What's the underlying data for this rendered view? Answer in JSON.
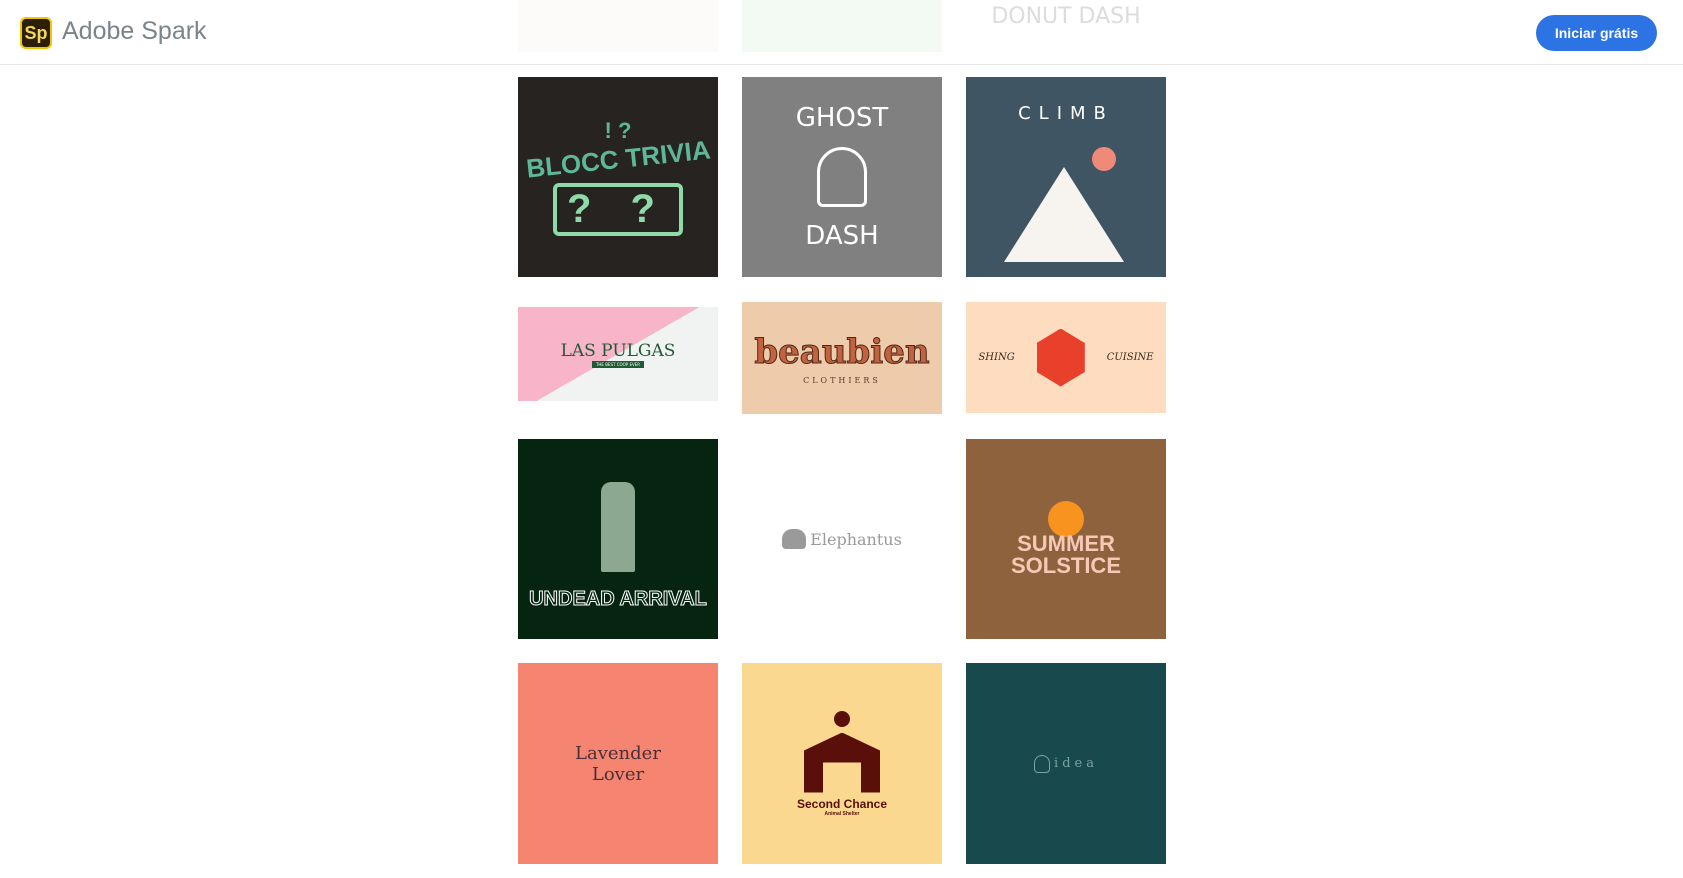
{
  "header": {
    "brand": "Adobe Spark",
    "logo_text": "Sp",
    "cta_label": "Iniciar grátis",
    "accent": "#2c73e3"
  },
  "tiles": [
    {
      "title": "",
      "bg": "#fcfbfa"
    },
    {
      "title": "",
      "bg": "#f3faf3"
    },
    {
      "title": "DONUT DASH",
      "bg": "#ffffff"
    },
    {
      "title": "BLOCC TRIVIA",
      "marks": "! ?",
      "dice": "? ?",
      "bg": "#272321"
    },
    {
      "line1": "GHOST",
      "line2": "DASH",
      "bg": "#808080"
    },
    {
      "title": "CLIMB",
      "bg": "#3f5563"
    },
    {
      "title": "LAS PULGAS",
      "subtitle": "THE BEST COOP EVER"
    },
    {
      "title": "beaubien",
      "subtitle": "CLOTHIERS",
      "bg": "#eecbab"
    },
    {
      "left": "SHING",
      "right": "CUISINE",
      "bg": "#fddcc0"
    },
    {
      "title": "UNDEAD ARRIVAL",
      "bg": "#062510"
    },
    {
      "title": "Elephantus",
      "bg": "#ffffff"
    },
    {
      "line1": "SUMMER",
      "line2": "SOLSTICE",
      "bg": "#8e623c"
    },
    {
      "line1": "Lavender",
      "line2": "Lover",
      "bg": "#f58571"
    },
    {
      "title": "Second Chance",
      "subtitle": "Animal Shelter",
      "bg": "#fad88f"
    },
    {
      "title": "idea",
      "bg": "#184a4d"
    }
  ]
}
